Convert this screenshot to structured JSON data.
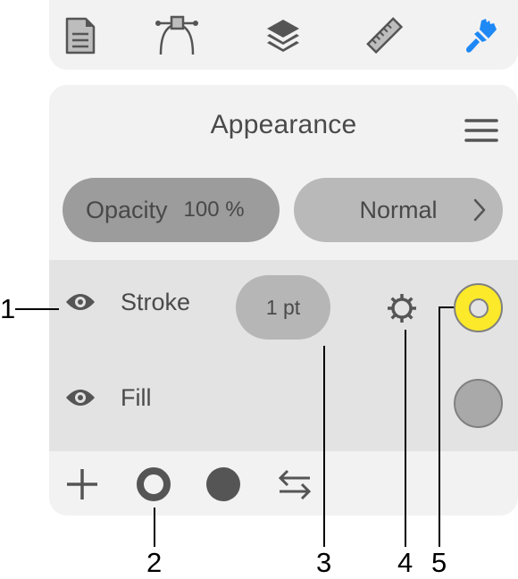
{
  "toolbar": {
    "tools": [
      {
        "name": "document",
        "icon": "document-icon",
        "active": false
      },
      {
        "name": "path",
        "icon": "bezier-path-icon",
        "active": false
      },
      {
        "name": "layers",
        "icon": "layers-icon",
        "active": false
      },
      {
        "name": "measure",
        "icon": "ruler-icon",
        "active": false
      },
      {
        "name": "appearance",
        "icon": "paintbrush-icon",
        "active": true
      }
    ],
    "active_color": "#1e88f5"
  },
  "panel": {
    "title": "Appearance",
    "opacity_label": "Opacity",
    "opacity_value": "100 %",
    "blend_mode": "Normal",
    "stroke": {
      "label": "Stroke",
      "visible": true,
      "width": "1 pt",
      "color": "#fbe92a"
    },
    "fill": {
      "label": "Fill",
      "visible": true,
      "color": "#a9a9a9"
    }
  },
  "bottom_bar": {
    "items": [
      "add",
      "stroke",
      "fill",
      "swap"
    ]
  },
  "callouts": [
    "1",
    "2",
    "3",
    "4",
    "5"
  ]
}
